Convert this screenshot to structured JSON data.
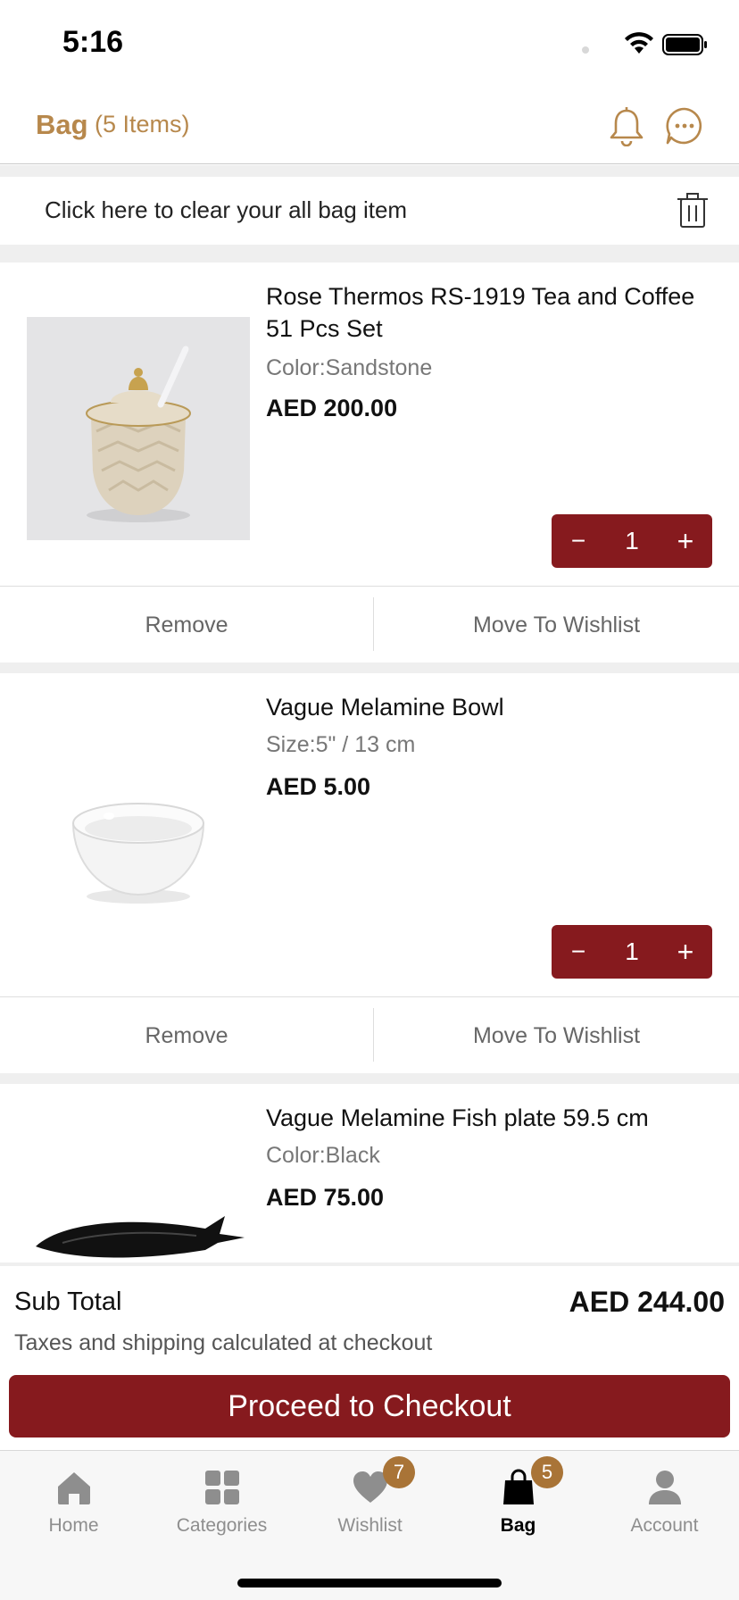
{
  "status_bar": {
    "time": "5:16"
  },
  "header": {
    "title": "Bag",
    "count": "(5 Items)"
  },
  "clear_bar": {
    "text": "Click here to clear your all bag item"
  },
  "items": [
    {
      "name": "Rose Thermos RS-1919 Tea and Coffee 51 Pcs Set",
      "variant": "Color:Sandstone",
      "price": "AED 200.00",
      "quantity": "1",
      "minus": "−",
      "plus": "+",
      "remove_label": "Remove",
      "wishlist_label": "Move To Wishlist"
    },
    {
      "name": "Vague Melamine Bowl",
      "variant": "Size:5\" / 13 cm",
      "price": "AED 5.00",
      "quantity": "1",
      "minus": "−",
      "plus": "+",
      "remove_label": "Remove",
      "wishlist_label": "Move To Wishlist"
    },
    {
      "name": "Vague Melamine Fish plate 59.5 cm",
      "variant": "Color:Black",
      "price": "AED 75.00"
    }
  ],
  "summary": {
    "subtotal_label": "Sub Total",
    "subtotal_value": "AED 244.00",
    "tax_note": "Taxes and shipping calculated at checkout",
    "checkout_label": "Proceed to Checkout"
  },
  "tabs": [
    {
      "label": "Home",
      "icon": "home-icon"
    },
    {
      "label": "Categories",
      "icon": "categories-icon"
    },
    {
      "label": "Wishlist",
      "icon": "heart-icon",
      "badge": "7"
    },
    {
      "label": "Bag",
      "icon": "bag-icon",
      "badge": "5",
      "active": true
    },
    {
      "label": "Account",
      "icon": "user-icon"
    }
  ],
  "colors": {
    "brand_gold": "#b7884c",
    "brand_maroon": "#861a1e",
    "badge": "#a97437"
  }
}
